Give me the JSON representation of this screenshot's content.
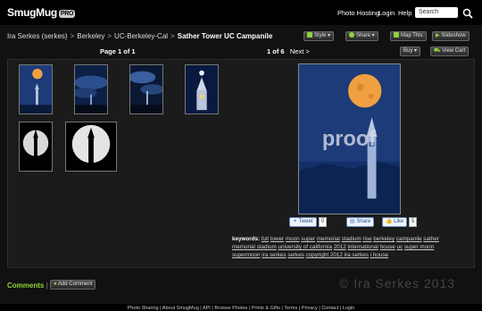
{
  "header": {
    "logo": "SmugMug",
    "logo_badge": "PRO",
    "links": [
      "Photo Hosting",
      "Login",
      "Help"
    ],
    "search_placeholder": "Search"
  },
  "breadcrumb": {
    "items": [
      "Ira Serkes (serkes)",
      "Berkeley",
      "UC-Berkeley-Cal"
    ],
    "current": "Sather Tower UC Campanile"
  },
  "toolbar": {
    "style": "Style",
    "share": "Share",
    "map": "Map This",
    "slideshow": "Slideshow"
  },
  "gallery": {
    "page_label": "Page 1 of 1",
    "position": "1 of 6",
    "next": "Next >",
    "buy": "Buy",
    "view_cart": "View Cart",
    "thumbnails": [
      "moon-tower-1",
      "tower-clouds-1",
      "tower-clouds-2",
      "tower-lit",
      "silhouette-moon-1",
      "silhouette-moon-2"
    ]
  },
  "photo": {
    "watermark": "proof"
  },
  "social": {
    "tweet": "Tweet",
    "tweet_count": "0",
    "share": "Share",
    "like": "Like",
    "like_count": "5"
  },
  "keywords": {
    "label": "keywords:",
    "items": [
      "full",
      "tower",
      "moon",
      "super",
      "memorial",
      "stadium",
      "rise",
      "berkeley",
      "campanile",
      "sather",
      "memorial stadium",
      "university of california",
      "2012",
      "international",
      "house",
      "uc",
      "super moon",
      "supermoon",
      "ira serkes",
      "serkes",
      "copyright 2012 ira serkes",
      "i house"
    ]
  },
  "comments": {
    "label": "Comments",
    "add": "Add Comment"
  },
  "page_watermark": "© Ira Serkes 2013",
  "footer": {
    "links": [
      "Photo Sharing",
      "About SmugMug",
      "API",
      "Browse Photos",
      "Prints & Gifts",
      "Terms",
      "Privacy",
      "Contact",
      "Login"
    ]
  },
  "colors": {
    "comments_green": "#8fd43a",
    "night_blue": "#1c3b78",
    "moon_orange": "#f0a040"
  }
}
